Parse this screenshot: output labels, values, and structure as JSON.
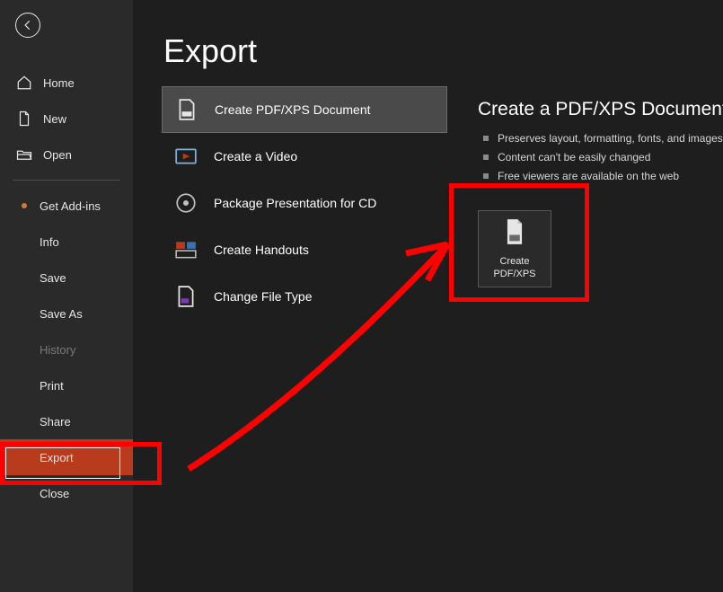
{
  "sidebar": {
    "items": [
      {
        "id": "home",
        "label": "Home",
        "icon": "home"
      },
      {
        "id": "new",
        "label": "New",
        "icon": "new"
      },
      {
        "id": "open",
        "label": "Open",
        "icon": "open"
      },
      {
        "id": "addins",
        "label": "Get Add-ins",
        "bullet": true
      },
      {
        "id": "info",
        "label": "Info"
      },
      {
        "id": "save",
        "label": "Save"
      },
      {
        "id": "saveas",
        "label": "Save As"
      },
      {
        "id": "history",
        "label": "History",
        "dim": true
      },
      {
        "id": "print",
        "label": "Print"
      },
      {
        "id": "share",
        "label": "Share"
      },
      {
        "id": "export",
        "label": "Export",
        "selected": true
      },
      {
        "id": "close",
        "label": "Close"
      }
    ]
  },
  "page": {
    "title": "Export"
  },
  "export_options": [
    {
      "id": "pdfxps",
      "label": "Create PDF/XPS Document",
      "selected": true
    },
    {
      "id": "video",
      "label": "Create a Video"
    },
    {
      "id": "package",
      "label": "Package Presentation for CD"
    },
    {
      "id": "handouts",
      "label": "Create Handouts"
    },
    {
      "id": "filetype",
      "label": "Change File Type"
    }
  ],
  "right_pane": {
    "title": "Create a PDF/XPS Document",
    "bullets": [
      "Preserves layout, formatting, fonts, and images",
      "Content can't be easily changed",
      "Free viewers are available on the web"
    ],
    "button": {
      "line1": "Create",
      "line2": "PDF/XPS"
    }
  }
}
